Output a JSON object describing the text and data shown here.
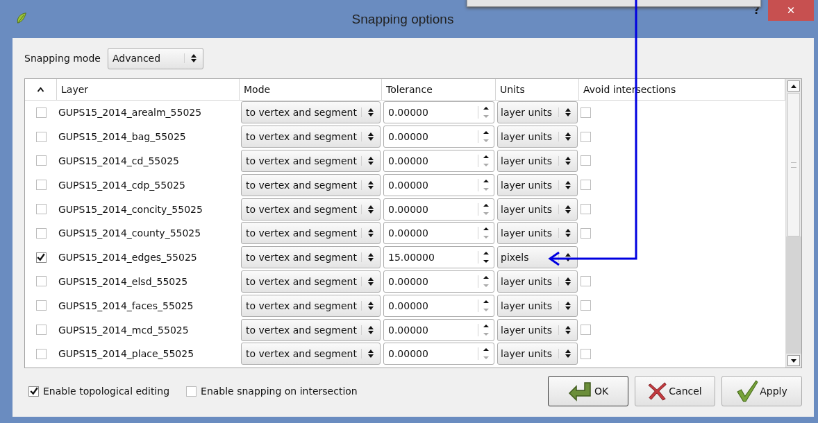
{
  "window": {
    "title": "Snapping options",
    "help": "?",
    "close": "✕"
  },
  "snapping_mode": {
    "label": "Snapping mode",
    "value": "Advanced"
  },
  "table": {
    "columns": [
      "Layer",
      "Mode",
      "Tolerance",
      "Units",
      "Avoid intersections"
    ],
    "rows": [
      {
        "checked": false,
        "layer": "GUPS15_2014_arealm_55025",
        "mode": "to vertex and segment",
        "tolerance": "0.00000",
        "down_disabled": true,
        "units": "layer units",
        "avoid_intersections": false
      },
      {
        "checked": false,
        "layer": "GUPS15_2014_bag_55025",
        "mode": "to vertex and segment",
        "tolerance": "0.00000",
        "down_disabled": true,
        "units": "layer units",
        "avoid_intersections": false
      },
      {
        "checked": false,
        "layer": "GUPS15_2014_cd_55025",
        "mode": "to vertex and segment",
        "tolerance": "0.00000",
        "down_disabled": true,
        "units": "layer units",
        "avoid_intersections": false
      },
      {
        "checked": false,
        "layer": "GUPS15_2014_cdp_55025",
        "mode": "to vertex and segment",
        "tolerance": "0.00000",
        "down_disabled": true,
        "units": "layer units",
        "avoid_intersections": false
      },
      {
        "checked": false,
        "layer": "GUPS15_2014_concity_55025",
        "mode": "to vertex and segment",
        "tolerance": "0.00000",
        "down_disabled": true,
        "units": "layer units",
        "avoid_intersections": false
      },
      {
        "checked": false,
        "layer": "GUPS15_2014_county_55025",
        "mode": "to vertex and segment",
        "tolerance": "0.00000",
        "down_disabled": true,
        "units": "layer units",
        "avoid_intersections": false
      },
      {
        "checked": true,
        "layer": "GUPS15_2014_edges_55025",
        "mode": "to vertex and segment",
        "tolerance": "15.00000",
        "down_disabled": false,
        "units": "pixels"
      },
      {
        "checked": false,
        "layer": "GUPS15_2014_elsd_55025",
        "mode": "to vertex and segment",
        "tolerance": "0.00000",
        "down_disabled": true,
        "units": "layer units",
        "avoid_intersections": false
      },
      {
        "checked": false,
        "layer": "GUPS15_2014_faces_55025",
        "mode": "to vertex and segment",
        "tolerance": "0.00000",
        "down_disabled": true,
        "units": "layer units",
        "avoid_intersections": false
      },
      {
        "checked": false,
        "layer": "GUPS15_2014_mcd_55025",
        "mode": "to vertex and segment",
        "tolerance": "0.00000",
        "down_disabled": true,
        "units": "layer units",
        "avoid_intersections": false
      },
      {
        "checked": false,
        "layer": "GUPS15_2014_place_55025",
        "mode": "to vertex and segment",
        "tolerance": "0.00000",
        "down_disabled": true,
        "units": "layer units",
        "avoid_intersections": false
      }
    ]
  },
  "options": [
    {
      "label": "Enable topological editing",
      "checked": true
    },
    {
      "label": "Enable snapping on intersection",
      "checked": false
    }
  ],
  "buttons": [
    {
      "kind": "ok",
      "label": "OK"
    },
    {
      "kind": "cancel",
      "label": "Cancel"
    },
    {
      "kind": "apply",
      "label": "Apply"
    }
  ]
}
